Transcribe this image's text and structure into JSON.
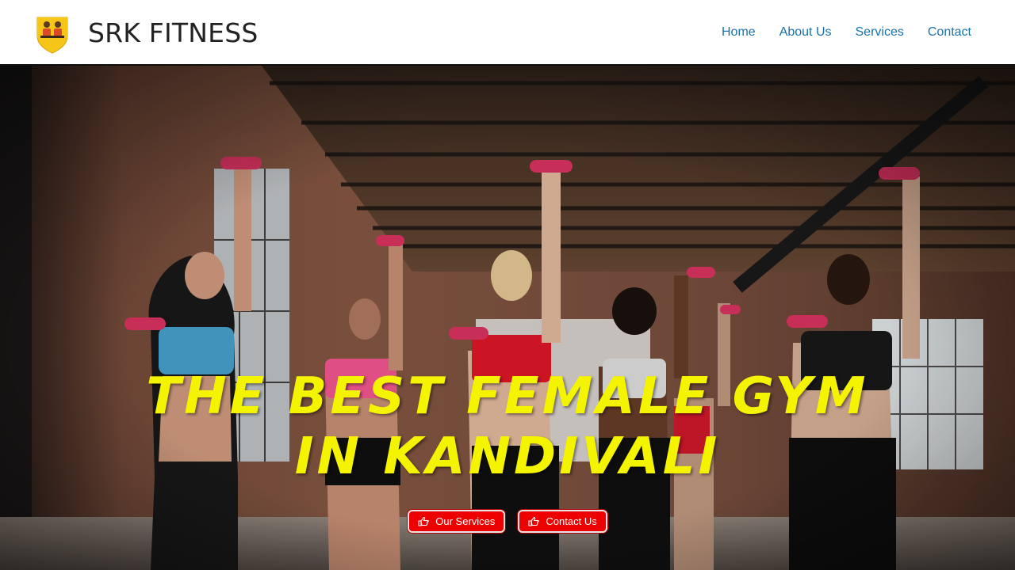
{
  "header": {
    "brand_name": "SRK FITNESS",
    "logo_icon": "gym-shield-logo-icon",
    "nav": [
      {
        "label": "Home"
      },
      {
        "label": "About Us"
      },
      {
        "label": "Services"
      },
      {
        "label": "Contact"
      }
    ],
    "nav_color": "#1a73a8"
  },
  "hero": {
    "headline_line1": "THE BEST FEMALE GYM",
    "headline_line2": "IN KANDIVALI",
    "headline_color": "#f4f400",
    "buttons": [
      {
        "label": "Our Services",
        "icon": "hand-pointing-icon"
      },
      {
        "label": "Contact Us",
        "icon": "hand-pointing-icon"
      }
    ],
    "button_color": "#ee0000"
  }
}
